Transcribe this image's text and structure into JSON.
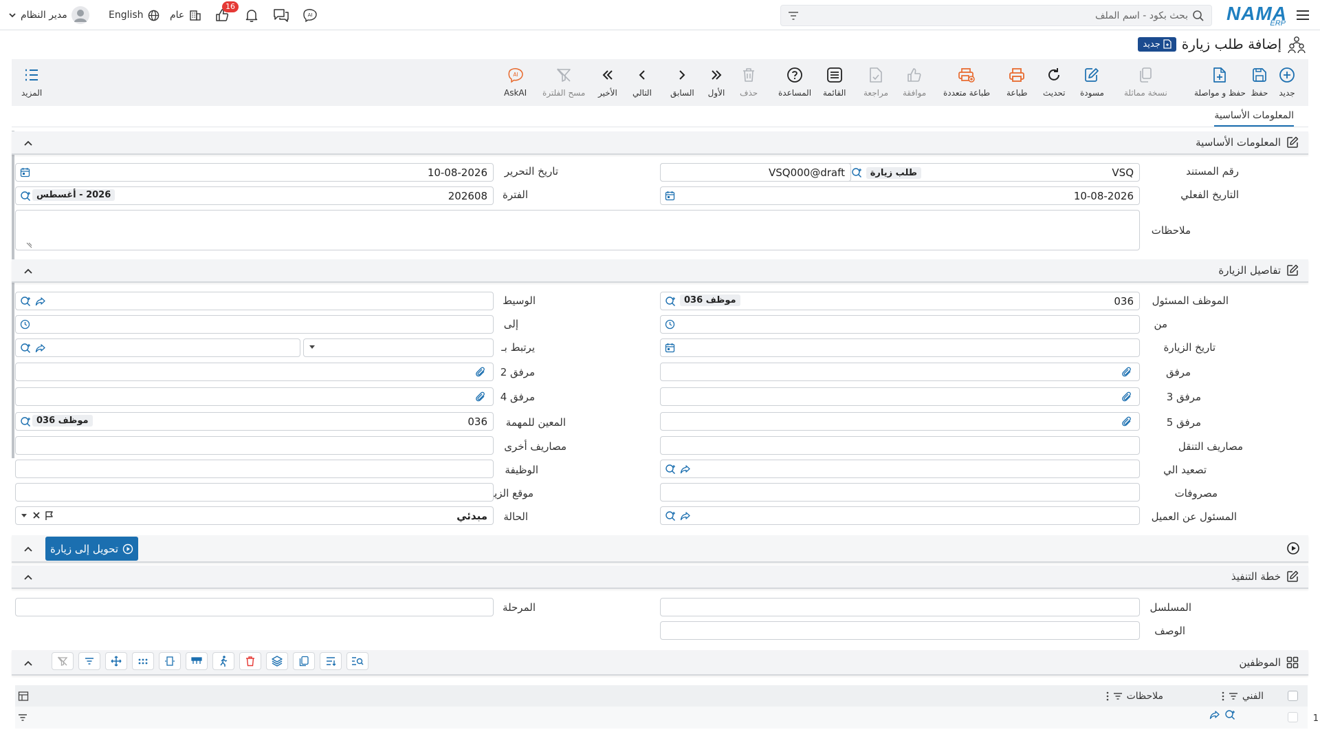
{
  "topbar": {
    "user_name": "مدير النظام",
    "language": "English",
    "scope": "عام",
    "likes_badge": "16",
    "search_placeholder": "بحث بكود - اسم الملف",
    "logo_main": "NAMA",
    "logo_sub": "ERP"
  },
  "page": {
    "title": "إضافة طلب زيارة",
    "new_badge": "جديد"
  },
  "toolbar": {
    "new": "جديد",
    "save": "حفظ",
    "save_continue": "حفظ و مواصلة",
    "duplicate": "نسخة مماثلة",
    "draft": "مسودة",
    "refresh": "تحديث",
    "print": "طباعة",
    "multi_print": "طباعة متعددة",
    "approve": "موافقة",
    "review": "مراجعة",
    "list": "القائمة",
    "help": "المساعدة",
    "delete": "حذف",
    "first": "الأول",
    "previous": "السابق",
    "next": "التالي",
    "last": "الأخير",
    "clear_filter": "مسح الفلترة",
    "askai": "AskAI",
    "more": "المزيد"
  },
  "tabs": {
    "basic_info": "المعلومات الأساسية"
  },
  "sections": {
    "basic": "المعلومات الأساسية",
    "visit_details": "تفاصيل الزيارة",
    "execution_plan": "خطة التنفيذ",
    "employees": "الموظفين"
  },
  "basic": {
    "doc_no_label": "رقم المستند",
    "doc_no_value": "VSQ",
    "doc_type_chip": "طلب زيارة",
    "doc_code": "VSQ000@draft",
    "edit_date_label": "تاريخ التحرير",
    "edit_date_value": "10-08-2026",
    "actual_date_label": "التاريخ الفعلي",
    "actual_date_value": "10-08-2026",
    "period_label": "الفترة",
    "period_value": "202608",
    "period_chip": "2026 - أغسطس",
    "notes_label": "ملاحظات"
  },
  "visit": {
    "responsible_label": "الموظف المسئول",
    "responsible_value": "036",
    "responsible_chip": "موظف 036",
    "broker_label": "الوسيط",
    "from_label": "من",
    "to_label": "إلى",
    "visit_date_label": "تاريخ الزيارة",
    "related_label": "يرتبط بـ",
    "attach_label": "مرفق",
    "attach2_label": "مرفق 2",
    "attach3_label": "مرفق 3",
    "attach4_label": "مرفق 4",
    "attach5_label": "مرفق 5",
    "assignee_label": "المعين للمهمة",
    "assignee_value": "036",
    "assignee_chip": "موظف 036",
    "transport_label": "مصاريف التنقل",
    "other_exp_label": "مصاريف أخرى",
    "escalate_label": "تصعيد الي",
    "job_label": "الوظيفة",
    "expenses_label": "مصروفات",
    "location_label": "موقع الزياره",
    "customer_rep_label": "المسئول عن العميل",
    "status_label": "الحالة",
    "status_value": "مبدئي"
  },
  "actions": {
    "convert_to_visit": "تحويل إلى زيارة"
  },
  "plan": {
    "serial_label": "المسلسل",
    "stage_label": "المرحلة",
    "description_label": "الوصف"
  },
  "grid": {
    "col_technician": "الفني",
    "col_notes": "ملاحظات",
    "rows": [
      {
        "index": "1"
      }
    ]
  },
  "colors": {
    "primary": "#1b6fb0",
    "badge": "#1b4b8f",
    "orange": "#e8692c",
    "danger": "#e53935"
  }
}
